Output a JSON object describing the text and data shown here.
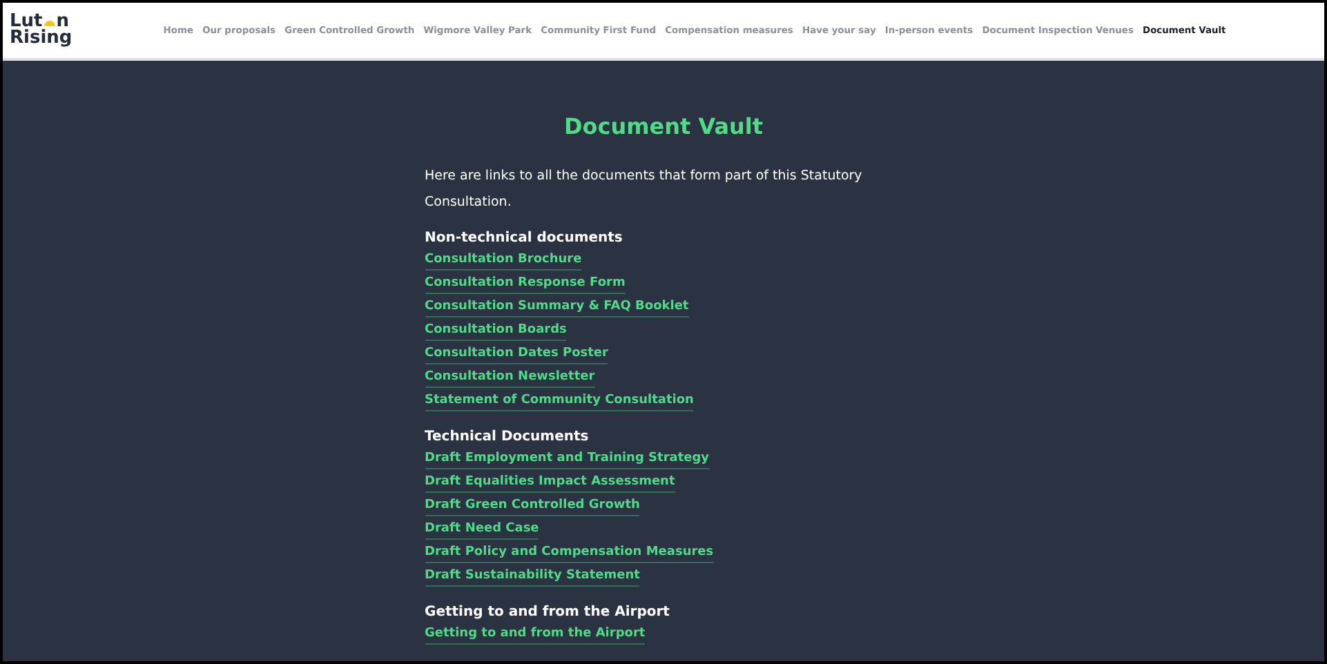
{
  "logo": {
    "before_mark": "Lut",
    "after_mark": "n",
    "second_line": "Rising"
  },
  "nav": [
    {
      "label": "Home",
      "selected": false
    },
    {
      "label": "Our proposals",
      "selected": false
    },
    {
      "label": "Green Controlled Growth",
      "selected": false
    },
    {
      "label": "Wigmore Valley Park",
      "selected": false
    },
    {
      "label": "Community First Fund",
      "selected": false
    },
    {
      "label": "Compensation measures",
      "selected": false
    },
    {
      "label": "Have your say",
      "selected": false
    },
    {
      "label": "In-person events",
      "selected": false
    },
    {
      "label": "Document Inspection Venues",
      "selected": false
    },
    {
      "label": "Document Vault",
      "selected": true
    }
  ],
  "title": "Document Vault",
  "intro": "Here are links to all the documents that form part of this Statutory Consultation.",
  "sections": [
    {
      "heading": "Non-technical documents",
      "links": [
        "Consultation Brochure",
        "Consultation Response Form",
        "Consultation Summary & FAQ Booklet",
        "Consultation Boards",
        "Consultation Dates Poster",
        "Consultation Newsletter",
        "Statement of Community Consultation"
      ]
    },
    {
      "heading": "Technical Documents",
      "links": [
        "Draft Employment and Training Strategy",
        "Draft Equalities Impact Assessment",
        "Draft Green Controlled Growth",
        "Draft Need Case",
        "Draft Policy and Compensation Measures",
        "Draft Sustainability Statement"
      ]
    },
    {
      "heading": "Getting to and from the Airport",
      "links": [
        "Getting to and from the Airport"
      ]
    }
  ]
}
